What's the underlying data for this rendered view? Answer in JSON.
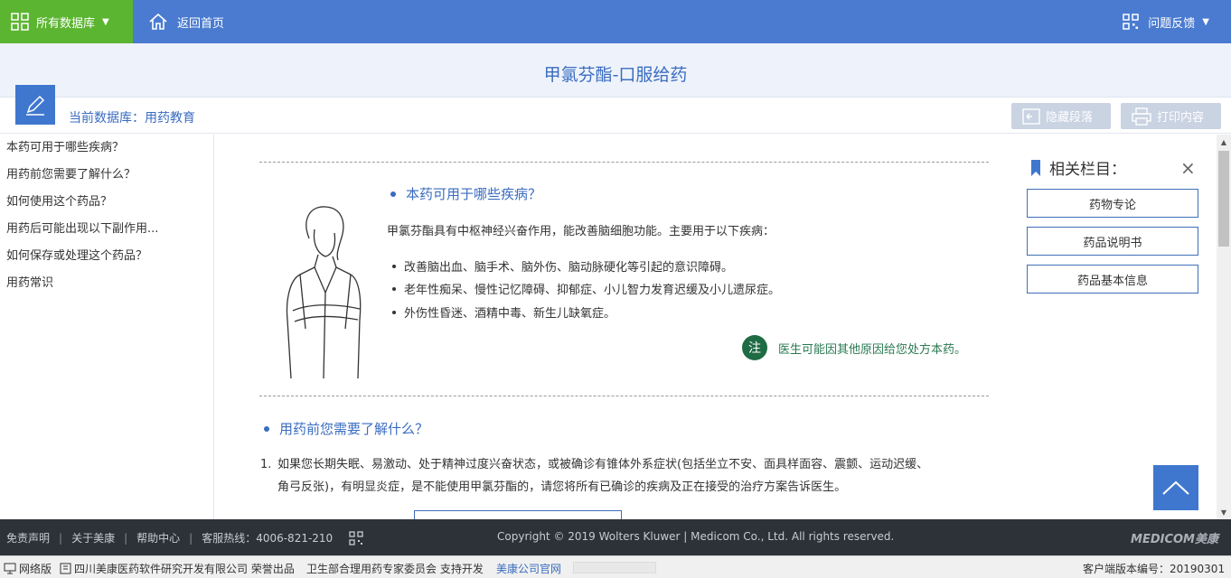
{
  "topbar": {
    "db_menu_label": "所有数据库",
    "home_label": "返回首页",
    "feedback_label": "问题反馈"
  },
  "page": {
    "title": "甲氯芬酯-口服给药",
    "current_db": "当前数据库：用药教育",
    "hide_paragraph": "隐藏段落",
    "print_content": "打印内容"
  },
  "sidebar": {
    "items": [
      "本药可用于哪些疾病？",
      "用药前您需要了解什么？",
      "如何使用这个药品？",
      "用药后可能出现以下副作用...",
      "如何保存或处理这个药品？",
      "用药常识"
    ]
  },
  "content": {
    "section1": {
      "heading": "本药可用于哪些疾病？",
      "intro": "甲氯芬酯具有中枢神经兴奋作用，能改善脑细胞功能。主要用于以下疾病：",
      "bullets": [
        "改善脑出血、脑手术、脑外伤、脑动脉硬化等引起的意识障碍。",
        "老年性痴呆、慢性记忆障碍、抑郁症、小儿智力发育迟缓及小儿遗尿症。",
        "外伤性昏迷、酒精中毒、新生儿缺氧症。"
      ],
      "note_badge": "注",
      "note_text": "医生可能因其他原因给您处方本药。"
    },
    "section2": {
      "heading": "用药前您需要了解什么？",
      "item1_number": "1.",
      "item1_line1": "如果您长期失眠、易激动、处于精神过度兴奋状态，或被确诊有锥体外系症状(包括坐立不安、面具样面容、震颤、运动迟缓、",
      "item1_line2": "角弓反张)，有明显炎症，是不能使用甲氯芬酯的，请您将所有已确诊的疾病及正在接受的治疗方案告诉医生。"
    }
  },
  "related": {
    "title": "相关栏目：",
    "close": "×",
    "buttons": [
      "药物专论",
      "药品说明书",
      "药品基本信息"
    ]
  },
  "footer": {
    "links": [
      "免责声明",
      "关于美康",
      "帮助中心",
      "客服热线：4006-821-210"
    ],
    "separator": "|",
    "copyright": "Copyright © 2019 Wolters Kluwer | Medicom Co., Ltd. All rights reserved.",
    "brand": "MEDICOM美康"
  },
  "statusbar": {
    "network": "网络版",
    "company": "四川美康医药软件研究开发有限公司 荣誉出品",
    "support": "卫生部合理用药专家委员会 支持开发",
    "official_site": "美康公司官网",
    "version": "客户端版本编号：20190301"
  },
  "colors": {
    "topbar": "#4a7bd0",
    "db_menu": "#5cb531",
    "accent": "#3a6cc0",
    "note": "#1f6b44",
    "footer": "#2d3239"
  }
}
